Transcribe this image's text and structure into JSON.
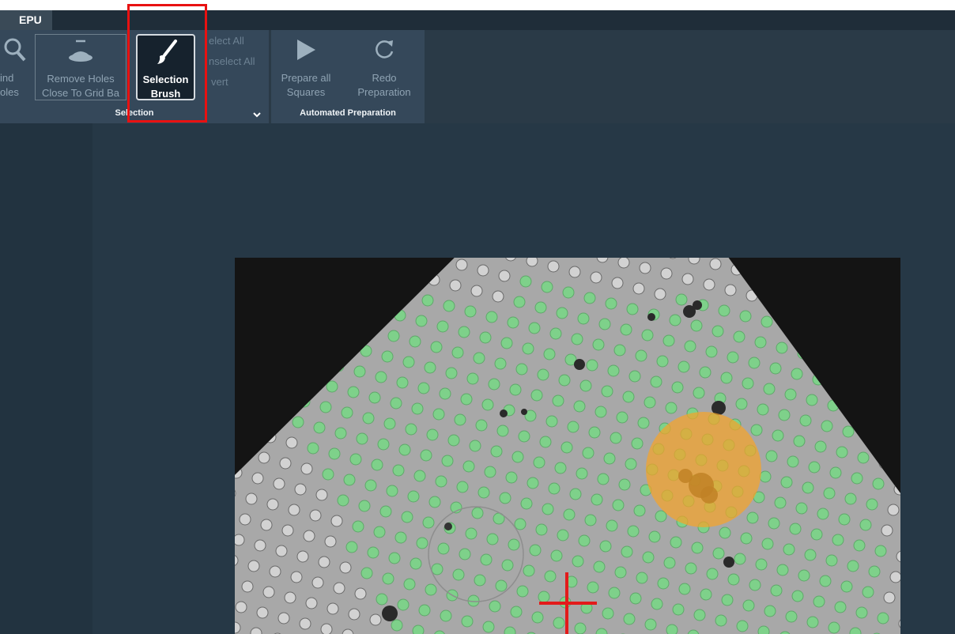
{
  "app": {
    "tab_label": "EPU"
  },
  "ribbon": {
    "find_holes": {
      "line1": "ind",
      "line2": "oles"
    },
    "remove_holes": {
      "line1": "Remove Holes",
      "line2": "Close To Grid Ba"
    },
    "selection_brush": {
      "line1": "Selection",
      "line2": "Brush"
    },
    "select_all": "elect All",
    "unselect_all": "nselect All",
    "invert": "vert",
    "prepare_all": {
      "line1": "Prepare all",
      "line2": "Squares"
    },
    "redo_prep": {
      "line1": "Redo",
      "line2": "Preparation"
    },
    "selection_group_label": "Selection",
    "automated_group_label": "Automated Preparation"
  },
  "colors": {
    "background": "#263846",
    "ribbon": "#35485a",
    "selected_hole": "#7ed18a",
    "brush": "#f5a32a",
    "highlight": "#e81111",
    "crosshair": "#e31b1b"
  },
  "icons": {
    "find_holes": "magnifier-icon",
    "remove_holes": "hole-remove-icon",
    "selection_brush": "brush-icon",
    "prepare_all": "play-icon",
    "redo": "redo-icon",
    "expand": "chevron-down-icon"
  }
}
